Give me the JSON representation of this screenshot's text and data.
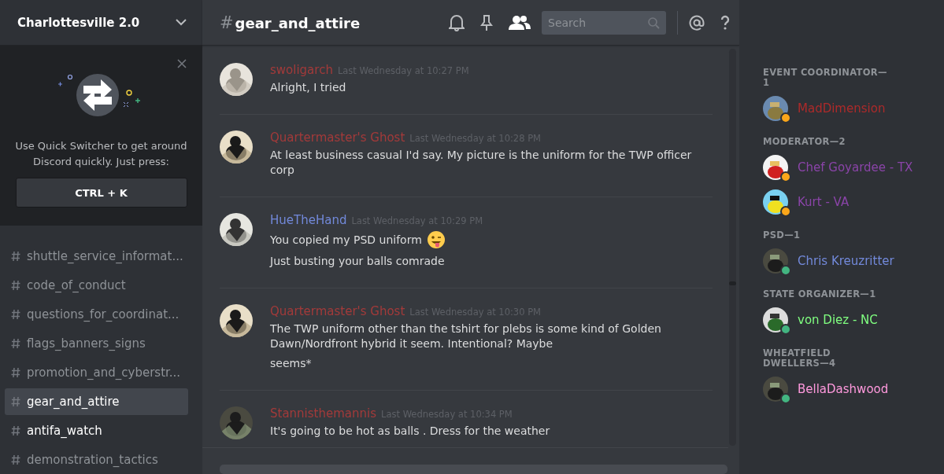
{
  "server": {
    "name": "Charlottesville 2.0"
  },
  "popup": {
    "text": "Use Quick Switcher to get around Discord quickly. Just press:",
    "shortcut": "CTRL + K"
  },
  "channels": [
    {
      "name": "shuttle_service_informat...",
      "selected": false,
      "unread": false
    },
    {
      "name": "code_of_conduct",
      "selected": false,
      "unread": false
    },
    {
      "name": "questions_for_coordinat...",
      "selected": false,
      "unread": false
    },
    {
      "name": "flags_banners_signs",
      "selected": false,
      "unread": false
    },
    {
      "name": "promotion_and_cyberstr...",
      "selected": false,
      "unread": false
    },
    {
      "name": "gear_and_attire",
      "selected": true,
      "unread": false
    },
    {
      "name": "antifa_watch",
      "selected": false,
      "unread": true
    },
    {
      "name": "demonstration_tactics",
      "selected": false,
      "unread": false
    }
  ],
  "header": {
    "hash": "#",
    "channel": "gear_and_attire",
    "search_placeholder": "Search"
  },
  "messages": [
    {
      "author": "swoligarch",
      "color": "#a33a3a",
      "time": "Last Wednesday at 10:27 PM",
      "lines": [
        {
          "text": "Alright, I tried",
          "emoji": false
        }
      ]
    },
    {
      "author": "Quartermaster's Ghost",
      "color": "#a33a3a",
      "time": "Last Wednesday at 10:28 PM",
      "lines": [
        {
          "text": "At least business casual I'd say. My picture is the uniform for the TWP officer corp",
          "emoji": false
        }
      ]
    },
    {
      "author": "HueTheHand",
      "color": "#7289da",
      "time": "Last Wednesday at 10:29 PM",
      "lines": [
        {
          "text": "You copied my PSD uniform",
          "emoji": true
        },
        {
          "text": "Just busting your balls comrade",
          "emoji": false
        }
      ]
    },
    {
      "author": "Quartermaster's Ghost",
      "color": "#a33a3a",
      "time": "Last Wednesday at 10:30 PM",
      "lines": [
        {
          "text": "The TWP uniform other than the tshirt for plebs is some kind of Golden Dawn/Nordfront hybrid it seem. Intentional? Maybe",
          "emoji": false
        },
        {
          "text": "seems*",
          "emoji": false
        }
      ]
    },
    {
      "author": "Stannisthemannis",
      "color": "#a33a3a",
      "time": "Last Wednesday at 10:34 PM",
      "lines": [
        {
          "text": "It's going to be hot as balls . Dress for the weather",
          "emoji": false
        }
      ]
    }
  ],
  "member_groups": [
    {
      "title": "EVENT COORDINATOR—1",
      "members": [
        {
          "name": "MadDimension",
          "color": "#ad2a2a",
          "idle": true
        }
      ]
    },
    {
      "title": "MODERATOR—2",
      "members": [
        {
          "name": "Chef Goyardee - TX",
          "color": "#8a44a8",
          "idle": true
        },
        {
          "name": "Kurt - VA",
          "color": "#8a44a8",
          "idle": true
        }
      ]
    },
    {
      "title": "PSD—1",
      "members": [
        {
          "name": "Chris Kreuzritter",
          "color": "#7289da",
          "idle": false
        }
      ]
    },
    {
      "title": "STATE ORGANIZER—1",
      "members": [
        {
          "name": "von Diez - NC",
          "color": "#80ff80",
          "idle": false
        }
      ]
    },
    {
      "title": "WHEATFIELD DWELLERS—4",
      "members": [
        {
          "name": "BellaDashwood",
          "color": "#ff99dd",
          "idle": false
        }
      ]
    }
  ]
}
